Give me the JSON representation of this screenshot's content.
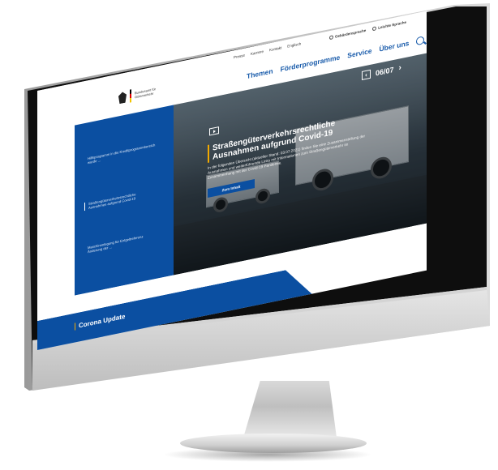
{
  "utility_nav": {
    "items": [
      "Presse",
      "Karriere",
      "Kontakt",
      "Englisch"
    ],
    "gebaerdensprache": "Gebärdensprache",
    "leichte_sprache": "Leichte Sprache"
  },
  "main_nav": {
    "items": [
      "Themen",
      "Förderprogramme",
      "Service",
      "Über uns"
    ]
  },
  "logo": {
    "text": "Bundesamt für Güterverkehr"
  },
  "sidebar": {
    "items": [
      {
        "label": "Hilfsprogramm in die Kreditprogrammbereich wurde ..."
      },
      {
        "label": "Straßengüterverkehrsrechtliche Ausnahmen aufgrund Covid-19"
      },
      {
        "label": "Maschinenlegung für Entgeltreferenz Änderung der ..."
      }
    ]
  },
  "hero": {
    "title": "Straßengüterverkehrsrechtliche Ausnahmen aufgrund Covid-19",
    "text": "In der folgenden Übersicht (aktueller Stand: 03.07.2021) finden Sie eine Zusammenstellung der Ausnahmen und weiterführende Links mit Informationen zum Straßengüterverkehr im Zusammenhang mit der Covid-19 Pandemie.",
    "button_label": "Zum Inhalt",
    "counter": "06/07"
  },
  "corona": {
    "title": "Corona Update"
  },
  "colors": {
    "brand_blue": "#0b4fa1",
    "accent_yellow": "#f2a900",
    "nav_blue": "#1a5cab"
  },
  "icons": {
    "search": "search-icon",
    "play": "play-icon",
    "prev": "chevron-left-icon",
    "next": "chevron-right-icon"
  }
}
